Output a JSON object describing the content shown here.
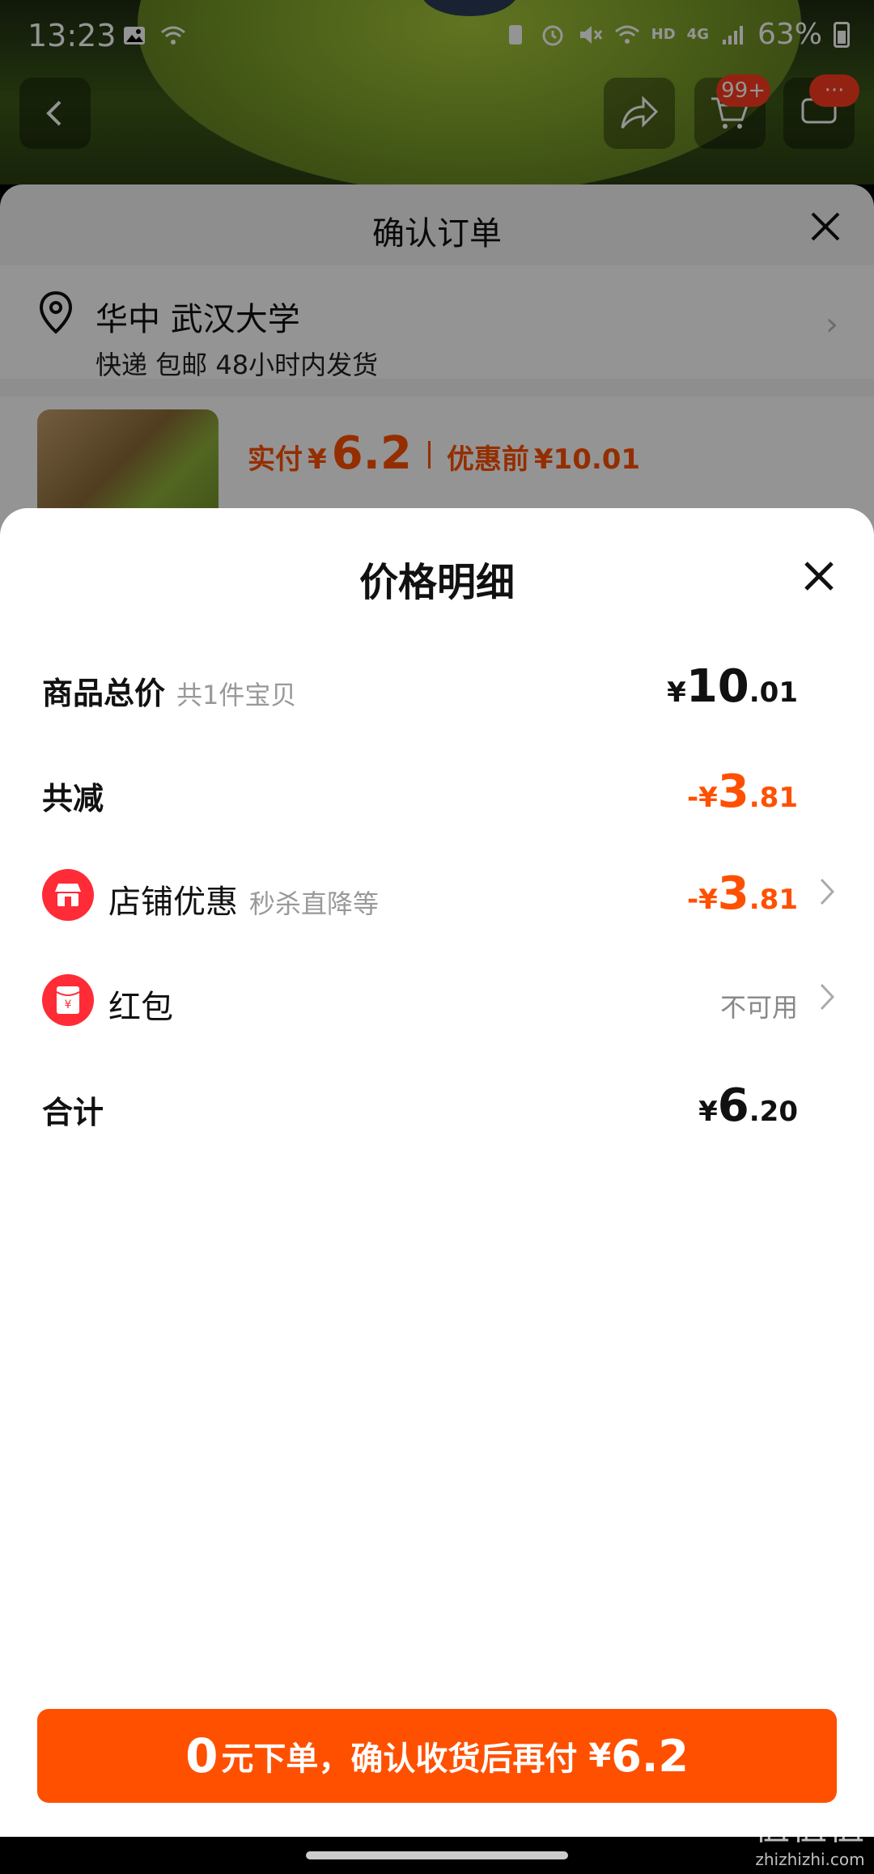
{
  "status_bar": {
    "time": "13:23",
    "network_label": "HD",
    "cell_label": "4G",
    "battery": "63%"
  },
  "top_nav": {
    "cart_badge": "99+",
    "message_badge": "···"
  },
  "order_sheet": {
    "title": "确认订单",
    "address_line": "华中 武汉大学",
    "delivery_line": "快递 包邮 48小时内发货",
    "paid_label": "实付",
    "paid_currency": "¥",
    "paid_value": "6.2",
    "before_label": "优惠前",
    "before_value": "¥10.01"
  },
  "price_detail": {
    "title": "价格明细",
    "rows": {
      "total": {
        "label": "商品总价",
        "sub": "共1件宝贝",
        "currency": "¥",
        "int": "10",
        "dec": ".01"
      },
      "discount": {
        "label": "共减",
        "currency": "-¥",
        "int": "3",
        "dec": ".81"
      },
      "shop": {
        "label": "店铺优惠",
        "sub": "秒杀直降等",
        "currency": "-¥",
        "int": "3",
        "dec": ".81"
      },
      "redpacket": {
        "label": "红包",
        "status": "不可用"
      },
      "sum": {
        "label": "合计",
        "currency": "¥",
        "int": "6",
        "dec": ".20"
      }
    },
    "cta": {
      "num": "0",
      "text": "元下单，确认收货后再付",
      "currency": "¥",
      "price": "6.2"
    }
  },
  "watermark": {
    "logo": "值值值",
    "domain": "zhizhizhi.com"
  },
  "colors": {
    "accent": "#ff5000",
    "icon_red": "#ff2b36"
  }
}
